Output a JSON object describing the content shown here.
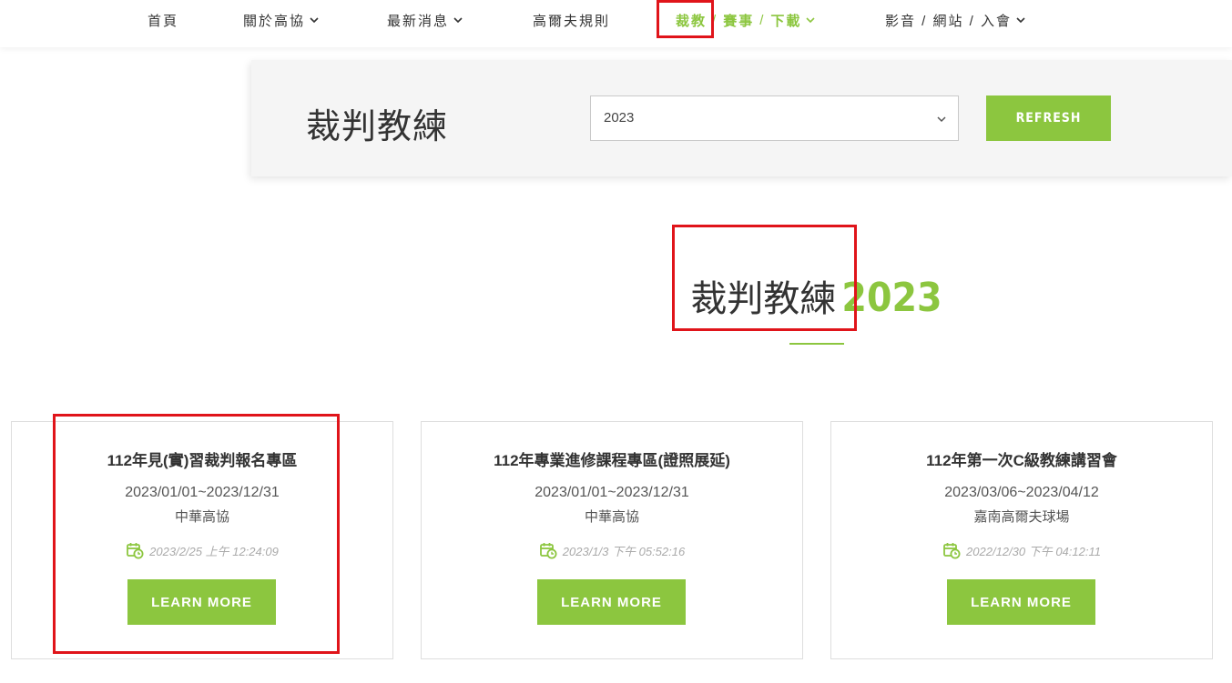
{
  "nav": {
    "items": [
      {
        "label": "首頁",
        "has_dropdown": false
      },
      {
        "label": "關於高協",
        "has_dropdown": true
      },
      {
        "label": "最新消息",
        "has_dropdown": true
      },
      {
        "label": "高爾夫規則",
        "has_dropdown": false
      },
      {
        "label_parts": [
          "裁教",
          "/",
          "賽事",
          "/",
          "下載"
        ],
        "has_dropdown": true,
        "active": true
      },
      {
        "label": "影音 / 網站 / 入會",
        "has_dropdown": true
      }
    ]
  },
  "filter": {
    "title": "裁判教練",
    "year_value": "2023",
    "refresh_label": "REFRESH"
  },
  "heading": {
    "main": "裁判教練",
    "year": "2023"
  },
  "cards": [
    {
      "title": "112年見(實)習裁判報名專區",
      "dates": "2023/01/01~2023/12/31",
      "org": "中華高協",
      "posted": "2023/2/25 上午 12:24:09",
      "button": "LEARN MORE"
    },
    {
      "title": "112年專業進修課程專區(證照展延)",
      "dates": "2023/01/01~2023/12/31",
      "org": "中華高協",
      "posted": "2023/1/3 下午 05:52:16",
      "button": "LEARN MORE"
    },
    {
      "title": "112年第一次C級教練講習會",
      "dates": "2023/03/06~2023/04/12",
      "org": "嘉南高爾夫球場",
      "posted": "2022/12/30 下午 04:12:11",
      "button": "LEARN MORE"
    }
  ],
  "colors": {
    "accent": "#8cc63f",
    "highlight_box": "#e0141a"
  },
  "icons": {
    "dropdown": "chevron-down-icon",
    "calendar": "calendar-clock-icon"
  }
}
